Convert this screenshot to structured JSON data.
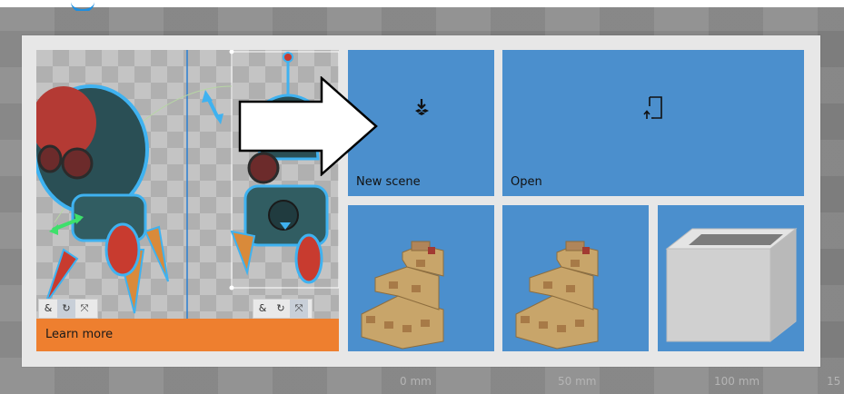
{
  "dialog": {
    "promo": {
      "banner_label": "Learn more",
      "left_toolbar": [
        "&",
        "↻",
        "⤧"
      ],
      "right_toolbar": [
        "&",
        "↻",
        "⤧"
      ]
    },
    "tiles": {
      "new_scene": {
        "label": "New scene",
        "icon": "new-scene-icon"
      },
      "open": {
        "label": "Open",
        "icon": "open-file-icon"
      },
      "samples": [
        {
          "name": "sample-castle-1"
        },
        {
          "name": "sample-castle-2"
        },
        {
          "name": "sample-box"
        }
      ]
    }
  },
  "ruler": {
    "labels": [
      "0 mm",
      "50 mm",
      "100 mm",
      "15"
    ]
  },
  "colors": {
    "tile_blue": "#4b8fcd",
    "promo_orange": "#ee7f2f",
    "dialog_bg": "#e7e7e7",
    "backdrop": "#878787"
  }
}
